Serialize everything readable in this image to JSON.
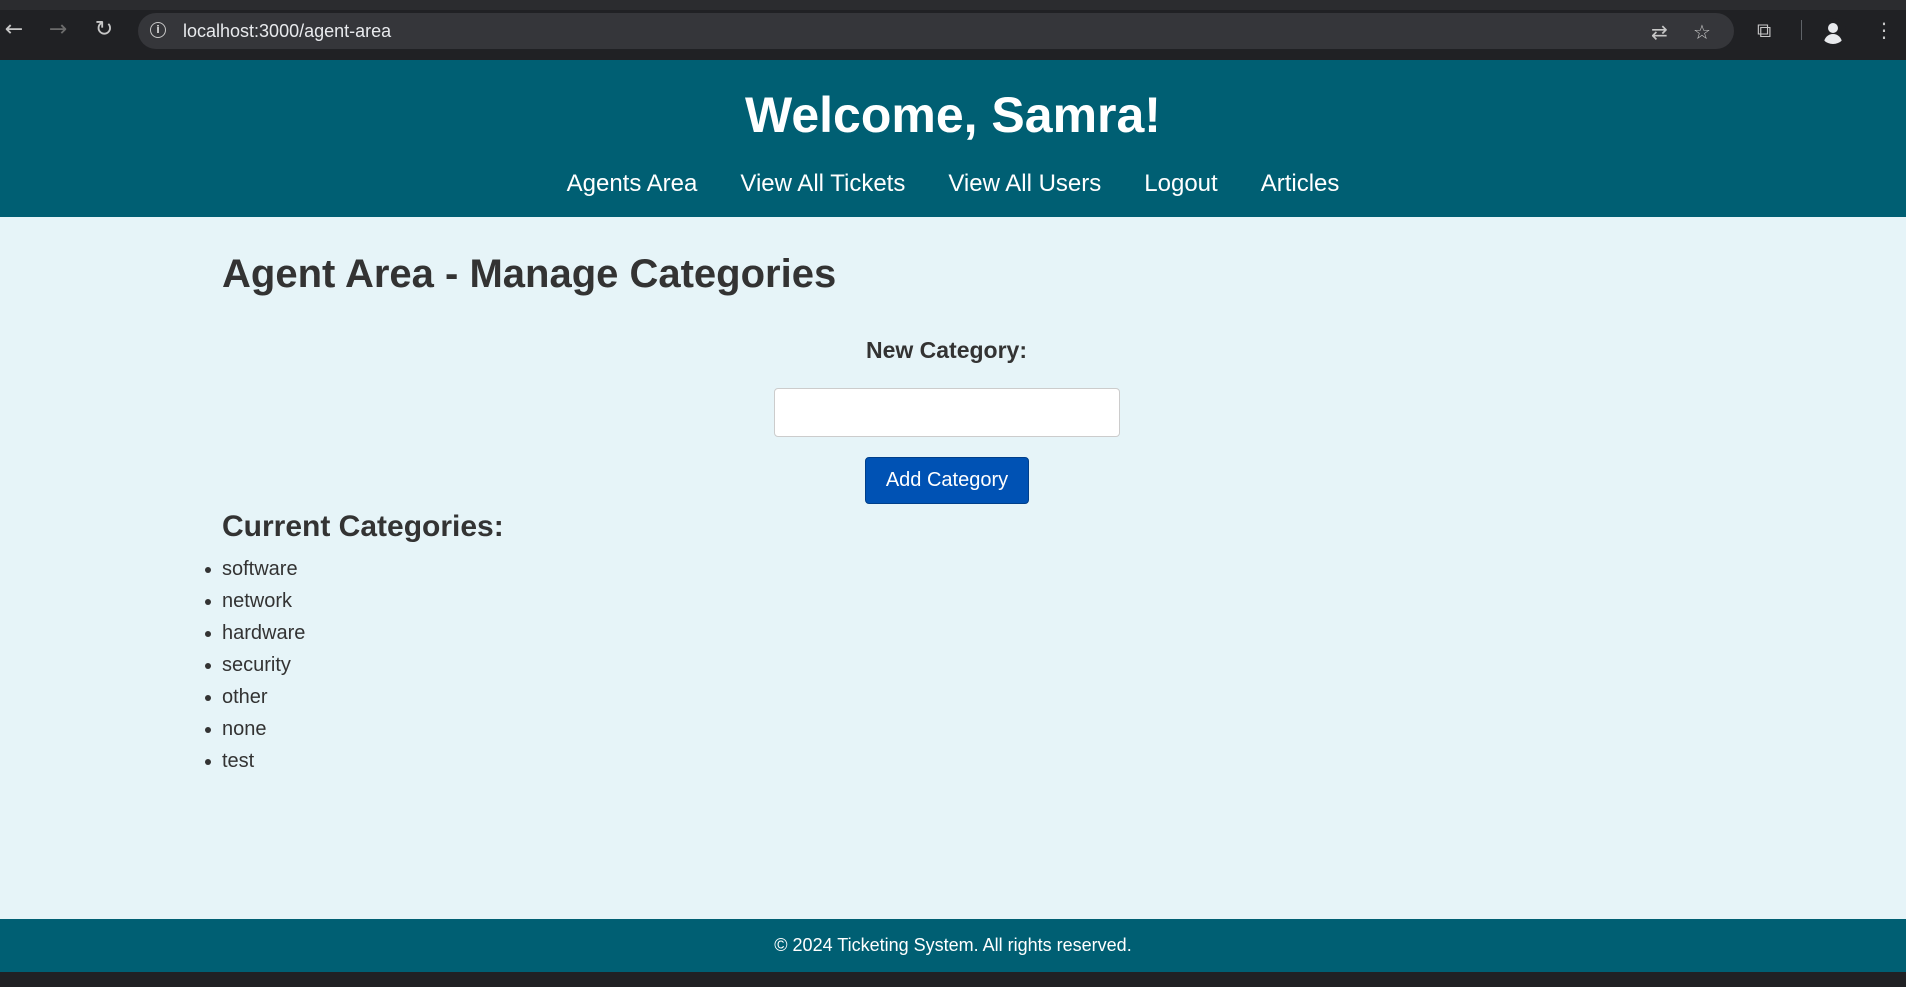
{
  "browser": {
    "url": "localhost:3000/agent-area",
    "icons": {
      "back": "back-arrow-icon",
      "forward": "forward-arrow-icon",
      "reload": "reload-icon",
      "info": "info-icon",
      "translate": "translate-icon",
      "bookmark": "star-icon",
      "extensions": "puzzle-icon",
      "profile": "profile-icon",
      "menu": "kebab-menu-icon"
    }
  },
  "header": {
    "welcome": "Welcome, Samra!",
    "nav": [
      {
        "label": "Agents Area"
      },
      {
        "label": "View All Tickets"
      },
      {
        "label": "View All Users"
      },
      {
        "label": "Logout"
      },
      {
        "label": "Articles"
      }
    ]
  },
  "main": {
    "title": "Agent Area - Manage Categories",
    "form": {
      "label": "New Category:",
      "input_value": "",
      "button_label": "Add Category"
    },
    "categories_title": "Current Categories:",
    "categories": [
      "software",
      "network",
      "hardware",
      "security",
      "other",
      "none",
      "test"
    ]
  },
  "footer": {
    "text": "© 2024 Ticketing System. All rights reserved."
  },
  "colors": {
    "header_bg": "#005f73",
    "page_bg": "#e6f4f8",
    "button_bg": "#0052b4",
    "text": "#333333"
  }
}
